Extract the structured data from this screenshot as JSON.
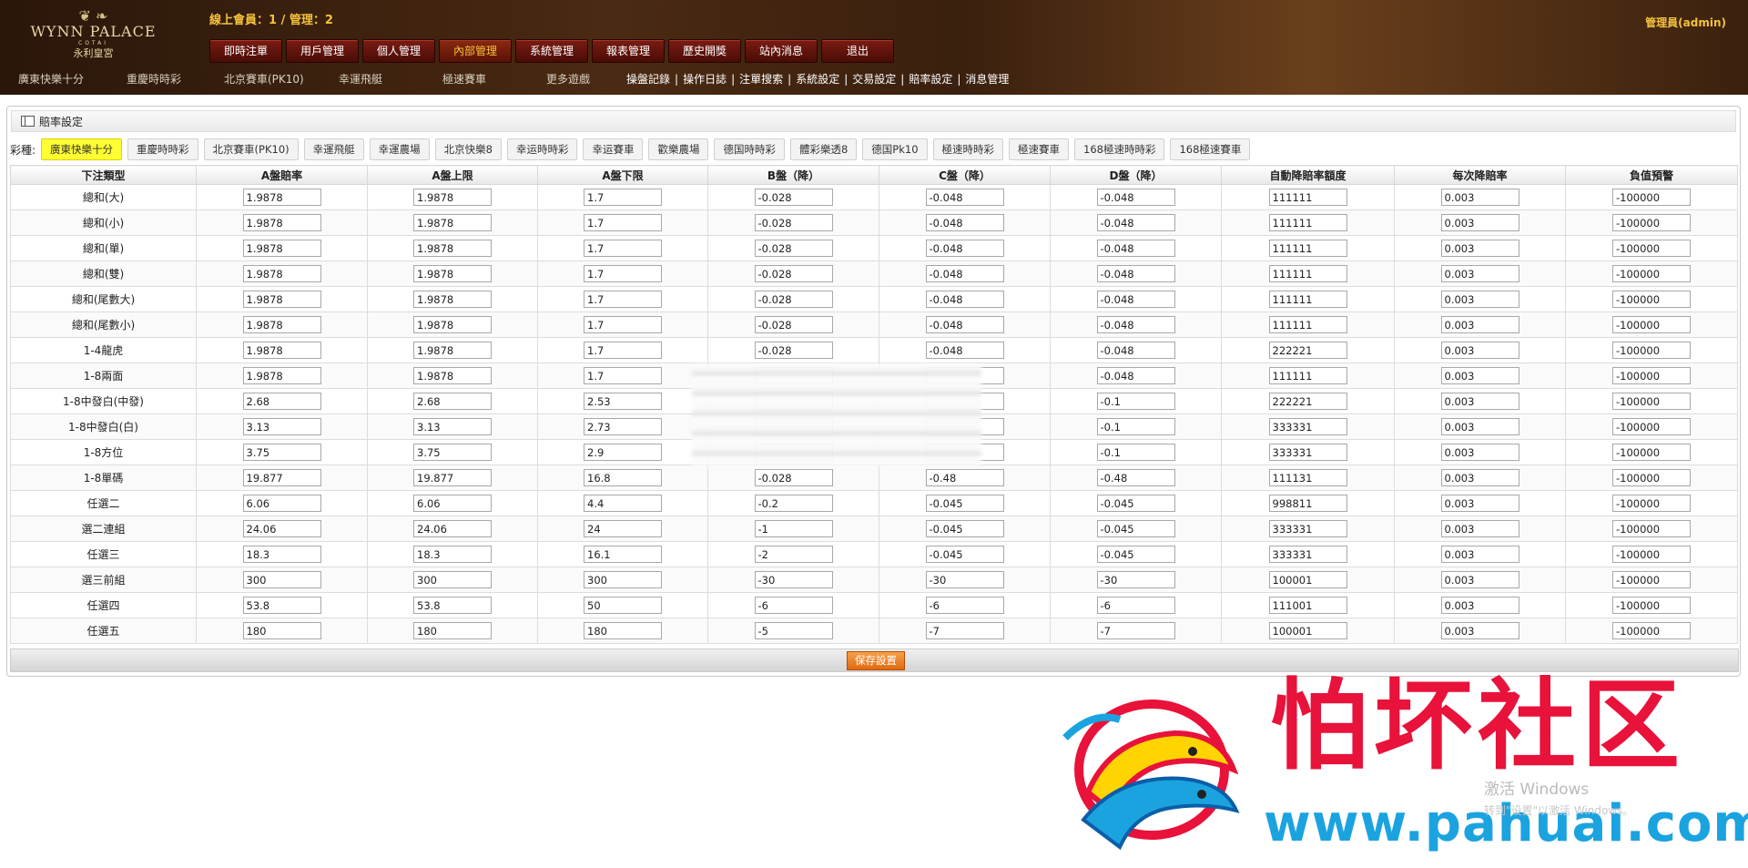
{
  "header": {
    "logo": {
      "name": "WYNN PALACE",
      "sub": "COTAI",
      "cn": "永利皇宮"
    },
    "online_text": "線上會員：1 / 管理：2",
    "admin_text": "管理員(admin)",
    "nav": [
      "即時注單",
      "用戶管理",
      "個人管理",
      "內部管理",
      "系統管理",
      "報表管理",
      "歷史開獎",
      "站內消息",
      "退出"
    ],
    "nav_active": "內部管理",
    "games": [
      "廣東快樂十分",
      "重慶時時彩",
      "北京賽車(PK10)",
      "幸運飛艇",
      "極速賽車",
      "更多遊戲"
    ],
    "sublinks": [
      "操盤記錄",
      "操作日誌",
      "注單搜索",
      "系統設定",
      "交易設定",
      "賠率設定",
      "消息管理"
    ]
  },
  "panel": {
    "title": "賠率設定",
    "category_label": "彩種:",
    "tabs": [
      "廣東快樂十分",
      "重慶時時彩",
      "北京賽車(PK10)",
      "幸運飛艇",
      "幸運農場",
      "北京快樂8",
      "幸运時時彩",
      "幸运賽車",
      "歡樂農場",
      "德国時時彩",
      "體彩樂透8",
      "德国Pk10",
      "極速時時彩",
      "極速賽車",
      "168極速時時彩",
      "168極速賽車"
    ],
    "active_tab": "廣東快樂十分",
    "columns": [
      "下注類型",
      "A盤賠率",
      "A盤上限",
      "A盤下限",
      "B盤（降）",
      "C盤（降）",
      "D盤（降）",
      "自動降賠率額度",
      "每次降賠率",
      "負值預警"
    ],
    "rows": [
      [
        "總和(大)",
        "1.9878",
        "1.9878",
        "1.7",
        "-0.028",
        "-0.048",
        "-0.048",
        "111111",
        "0.003",
        "-100000"
      ],
      [
        "總和(小)",
        "1.9878",
        "1.9878",
        "1.7",
        "-0.028",
        "-0.048",
        "-0.048",
        "111111",
        "0.003",
        "-100000"
      ],
      [
        "總和(單)",
        "1.9878",
        "1.9878",
        "1.7",
        "-0.028",
        "-0.048",
        "-0.048",
        "111111",
        "0.003",
        "-100000"
      ],
      [
        "總和(雙)",
        "1.9878",
        "1.9878",
        "1.7",
        "-0.028",
        "-0.048",
        "-0.048",
        "111111",
        "0.003",
        "-100000"
      ],
      [
        "總和(尾數大)",
        "1.9878",
        "1.9878",
        "1.7",
        "-0.028",
        "-0.048",
        "-0.048",
        "111111",
        "0.003",
        "-100000"
      ],
      [
        "總和(尾數小)",
        "1.9878",
        "1.9878",
        "1.7",
        "-0.028",
        "-0.048",
        "-0.048",
        "111111",
        "0.003",
        "-100000"
      ],
      [
        "1-4龍虎",
        "1.9878",
        "1.9878",
        "1.7",
        "-0.028",
        "-0.048",
        "-0.048",
        "222221",
        "0.003",
        "-100000"
      ],
      [
        "1-8兩面",
        "1.9878",
        "1.9878",
        "1.7",
        "",
        "",
        "-0.048",
        "111111",
        "0.003",
        "-100000"
      ],
      [
        "1-8中發白(中發)",
        "2.68",
        "2.68",
        "2.53",
        "",
        "",
        "-0.1",
        "222221",
        "0.003",
        "-100000"
      ],
      [
        "1-8中發白(白)",
        "3.13",
        "3.13",
        "2.73",
        "",
        "",
        "-0.1",
        "333331",
        "0.003",
        "-100000"
      ],
      [
        "1-8方位",
        "3.75",
        "3.75",
        "2.9",
        "",
        "",
        "-0.1",
        "333331",
        "0.003",
        "-100000"
      ],
      [
        "1-8單碼",
        "19.877",
        "19.877",
        "16.8",
        "-0.028",
        "-0.48",
        "-0.48",
        "111131",
        "0.003",
        "-100000"
      ],
      [
        "任選二",
        "6.06",
        "6.06",
        "4.4",
        "-0.2",
        "-0.045",
        "-0.045",
        "998811",
        "0.003",
        "-100000"
      ],
      [
        "選二連組",
        "24.06",
        "24.06",
        "24",
        "-1",
        "-0.045",
        "-0.045",
        "333331",
        "0.003",
        "-100000"
      ],
      [
        "任選三",
        "18.3",
        "18.3",
        "16.1",
        "-2",
        "-0.045",
        "-0.045",
        "333331",
        "0.003",
        "-100000"
      ],
      [
        "選三前組",
        "300",
        "300",
        "300",
        "-30",
        "-30",
        "-30",
        "100001",
        "0.003",
        "-100000"
      ],
      [
        "任選四",
        "53.8",
        "53.8",
        "50",
        "-6",
        "-6",
        "-6",
        "111001",
        "0.003",
        "-100000"
      ],
      [
        "任選五",
        "180",
        "180",
        "180",
        "-5",
        "-7",
        "-7",
        "100001",
        "0.003",
        "-100000"
      ]
    ],
    "save_label": "保存設置"
  },
  "watermark": {
    "text": "怕坏社区",
    "url": "www.pahuai.com",
    "activate_line1": "激活 Windows",
    "activate_line2": "转到\"设置\"以激活 Windows。"
  },
  "colors": {
    "header_bg": "#3a200e",
    "nav_btn": "#6a160e",
    "highlight_tab": "#ffff33",
    "save_btn": "#f08a2a",
    "wm_red": "#e8123a",
    "wm_blue": "#1ba3e0"
  }
}
